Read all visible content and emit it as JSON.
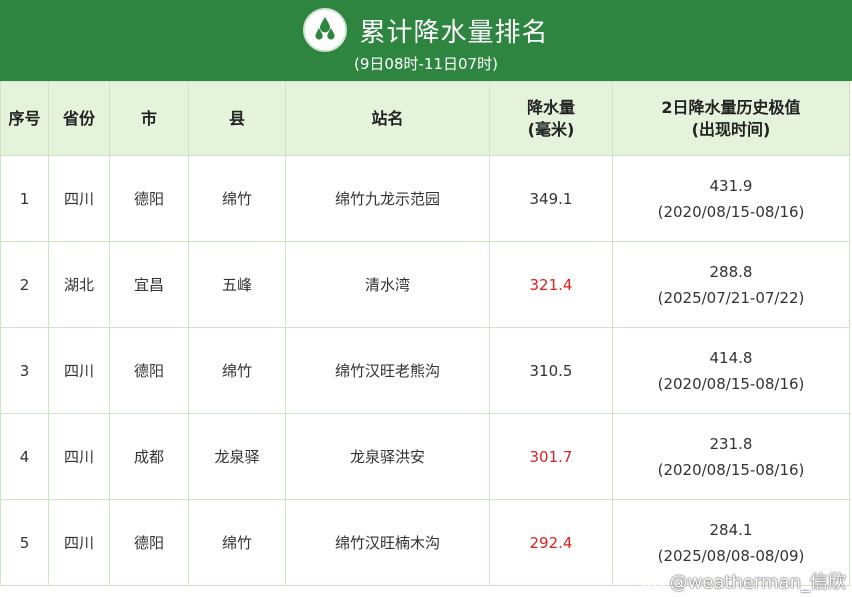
{
  "header": {
    "title": "累计降水量排名",
    "subtitle": "(9日08时-11日07时)",
    "icon": "raindrops-icon"
  },
  "columns": {
    "rank": "序号",
    "province": "省份",
    "city": "市",
    "county": "县",
    "station": "站名",
    "precip_line1": "降水量",
    "precip_line2": "(毫米)",
    "record_line1": "2日降水量历史极值",
    "record_line2": "(出现时间)"
  },
  "rows": [
    {
      "rank": "1",
      "province": "四川",
      "city": "德阳",
      "county": "绵竹",
      "station": "绵竹九龙示范园",
      "precip": "349.1",
      "precip_red": false,
      "record": "431.9",
      "record_date": "(2020/08/15-08/16)"
    },
    {
      "rank": "2",
      "province": "湖北",
      "city": "宜昌",
      "county": "五峰",
      "station": "清水湾",
      "precip": "321.4",
      "precip_red": true,
      "record": "288.8",
      "record_date": "(2025/07/21-07/22)"
    },
    {
      "rank": "3",
      "province": "四川",
      "city": "德阳",
      "county": "绵竹",
      "station": "绵竹汉旺老熊沟",
      "precip": "310.5",
      "precip_red": false,
      "record": "414.8",
      "record_date": "(2020/08/15-08/16)"
    },
    {
      "rank": "4",
      "province": "四川",
      "city": "成都",
      "county": "龙泉驿",
      "station": "龙泉驿洪安",
      "precip": "301.7",
      "precip_red": true,
      "record": "231.8",
      "record_date": "(2020/08/15-08/16)"
    },
    {
      "rank": "5",
      "province": "四川",
      "city": "德阳",
      "county": "绵竹",
      "station": "绵竹汉旺楠木沟",
      "precip": "292.4",
      "precip_red": true,
      "record": "284.1",
      "record_date": "(2025/08/08-08/09)"
    }
  ],
  "colors": {
    "banner": "#2e8540",
    "header_row": "#e6f3dc",
    "highlight": "#e02020"
  },
  "watermark": {
    "text": "@weatherman_信欣",
    "icon": "weibo-icon"
  }
}
